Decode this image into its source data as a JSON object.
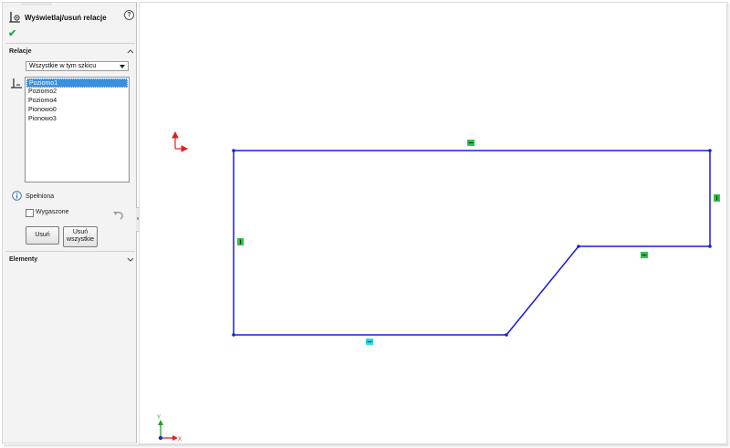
{
  "property_manager": {
    "title": "Wyświetlaj/usuń relacje",
    "help_symbol": "?",
    "ok_symbol": "✔",
    "icons": {
      "header": "display-delete-relations-icon",
      "help": "help-icon",
      "ok": "checkmark-icon",
      "relation": "horizontal-relation-icon",
      "info": "info-icon",
      "undo": "undo-icon"
    }
  },
  "relations_section": {
    "title": "Relacje",
    "filter_selected": "Wszystkie w tym szkicu",
    "items": [
      {
        "label": "Poziomo1",
        "selected": true
      },
      {
        "label": "Poziomo2",
        "selected": false
      },
      {
        "label": "Poziomo4",
        "selected": false
      },
      {
        "label": "Pionowo0",
        "selected": false
      },
      {
        "label": "Pionowo3",
        "selected": false
      }
    ],
    "status": "Spełniona",
    "suppressed_label": "Wygaszone",
    "suppressed_checked": false,
    "delete_button": "Usuń",
    "delete_all_button": "Usuń\nwszystkie"
  },
  "entities_section": {
    "title": "Elementy"
  },
  "canvas": {
    "line_color": "#1a1adf",
    "relation_badge_color": "#2fc24a",
    "selected_badge_color": "#36d7e6",
    "axis_colors": {
      "x": "#e02020",
      "y": "#2a9a2a",
      "z": "#2030c0"
    },
    "triad_labels": {
      "x": "X",
      "y": "Y"
    }
  },
  "colors": {
    "panel_bg": "#f3f3f3",
    "selection_blue": "#3a8fde"
  }
}
